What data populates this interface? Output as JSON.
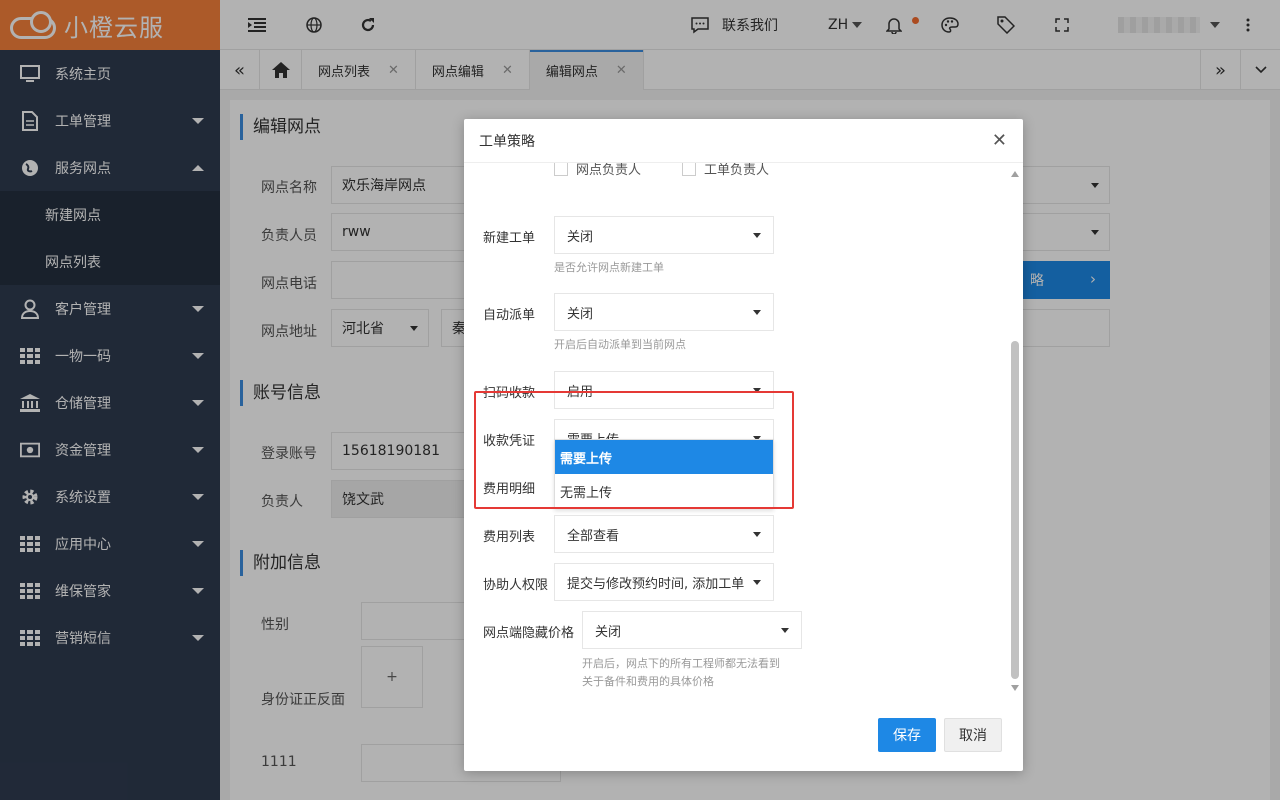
{
  "app": {
    "name": "小橙云服"
  },
  "colors": {
    "brand": "#f7823b",
    "sidebar_bg": "#2f3b50",
    "accent": "#1e88e5",
    "highlight": "#e53935"
  },
  "sidebar": {
    "items": [
      {
        "label": "系统主页",
        "icon": "monitor-icon"
      },
      {
        "label": "工单管理",
        "icon": "document-icon"
      },
      {
        "label": "服务网点",
        "icon": "globe-icon",
        "expanded": true,
        "children": [
          "新建网点",
          "网点列表"
        ]
      },
      {
        "label": "客户管理",
        "icon": "user-icon"
      },
      {
        "label": "一物一码",
        "icon": "grid-icon"
      },
      {
        "label": "仓储管理",
        "icon": "bank-icon"
      },
      {
        "label": "资金管理",
        "icon": "money-icon"
      },
      {
        "label": "系统设置",
        "icon": "gear-icon"
      },
      {
        "label": "应用中心",
        "icon": "grid-icon"
      },
      {
        "label": "维保管家",
        "icon": "grid-icon"
      },
      {
        "label": "营销短信",
        "icon": "grid-icon"
      }
    ]
  },
  "header": {
    "contact": "联系我们",
    "lang": "ZH"
  },
  "tabs": [
    {
      "label": "网点列表"
    },
    {
      "label": "网点编辑"
    },
    {
      "label": "编辑网点",
      "active": true
    }
  ],
  "page": {
    "section_edit": "编辑网点",
    "name_label": "网点名称",
    "name_value": "欢乐海岸网点",
    "owner_label": "负责人员",
    "owner_value": "rww",
    "phone_label": "网点电话",
    "address_label": "网点地址",
    "province": "河北省",
    "city_partial": "秦",
    "strategy_btn_partial": "略",
    "section_account": "账号信息",
    "login_label": "登录账号",
    "login_value": "15618190181",
    "person_label": "负责人",
    "person_value": "饶文武",
    "section_extra": "附加信息",
    "gender_label": "性别",
    "idcard_label": "身份证正反面",
    "upload_plus": "+",
    "custom_label": "1111"
  },
  "modal": {
    "title": "工单策略",
    "checkbox_a": "网点负责人",
    "checkbox_b": "工单负责人",
    "fields": {
      "new_order": {
        "label": "新建工单",
        "value": "关闭",
        "hint": "是否允许网点新建工单"
      },
      "auto_dispatch": {
        "label": "自动派单",
        "value": "关闭",
        "hint": "开启后自动派单到当前网点"
      },
      "scan_pay": {
        "label": "扫码收款",
        "value": "启用"
      },
      "receipt": {
        "label": "收款凭证",
        "value": "需要上传"
      },
      "fee_detail": {
        "label": "费用明细"
      },
      "fee_list": {
        "label": "费用列表",
        "value": "全部查看"
      },
      "helper_perm": {
        "label": "协助人权限",
        "value": "提交与修改预约时间, 添加工单"
      },
      "hide_price": {
        "label": "网点端隐藏价格",
        "value": "关闭",
        "hint1": "开启后，网点下的所有工程师都无法看到",
        "hint2": "关于备件和费用的具体价格"
      }
    },
    "dropdown_options": [
      "需要上传",
      "无需上传"
    ],
    "save": "保存",
    "cancel": "取消"
  }
}
